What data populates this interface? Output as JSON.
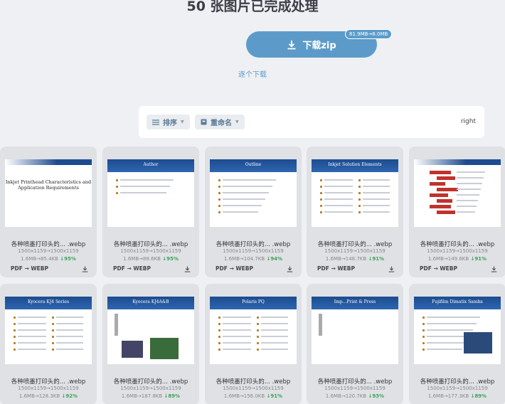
{
  "header": {
    "title": "50 张图片已完成处理",
    "download_label": "下载zip",
    "size_badge": "81.9MB→8.0MB",
    "each_download_label": "逐个下载"
  },
  "toolbar": {
    "sort_label": "排序",
    "rename_label": "重命名",
    "right_label": "right"
  },
  "colors": {
    "accent": "#5c9bc9",
    "saving": "#3fa05a",
    "card_bg": "#dfe1e5"
  },
  "cards": [
    {
      "name": "各种喷墨打印头的...",
      "ext": ".webp",
      "dims": "1500x1159→1500x1159",
      "from": "1.6MB",
      "to": "85.4KB",
      "pct": "95%",
      "fmt_from": "PDF",
      "fmt_to": "WEBP",
      "slide_title": "Inkjet Printhead Characteristics and Application Requirements"
    },
    {
      "name": "各种喷墨打印头的...",
      "ext": ".webp",
      "dims": "1500x1159→1500x1159",
      "from": "1.6MB",
      "to": "88.6KB",
      "pct": "95%",
      "fmt_from": "PDF",
      "fmt_to": "WEBP",
      "slide_title": "Author"
    },
    {
      "name": "各种喷墨打印头的...",
      "ext": ".webp",
      "dims": "1500x1159→1500x1159",
      "from": "1.6MB",
      "to": "104.7KB",
      "pct": "94%",
      "fmt_from": "PDF",
      "fmt_to": "WEBP",
      "slide_title": "Outline"
    },
    {
      "name": "各种喷墨打印头的...",
      "ext": ".webp",
      "dims": "1500x1159→1500x1159",
      "from": "1.6MB",
      "to": "148.7KB",
      "pct": "91%",
      "fmt_from": "PDF",
      "fmt_to": "WEBP",
      "slide_title": "Inkjet Solution Elements"
    },
    {
      "name": "各种喷墨打印头的...",
      "ext": ".webp",
      "dims": "1500x1159→1500x1159",
      "from": "1.6MB",
      "to": "149.6KB",
      "pct": "91%",
      "fmt_from": "PDF",
      "fmt_to": "WEBP",
      "slide_title": ""
    },
    {
      "name": "各种喷墨打印头的...",
      "ext": ".webp",
      "dims": "1500x1159→1500x1159",
      "from": "1.6MB",
      "to": "128.3KB",
      "pct": "92%",
      "slide_title": "Kyocera KJ4 Series"
    },
    {
      "name": "各种喷墨打印头的...",
      "ext": ".webp",
      "dims": "1500x1159→1500x1159",
      "from": "1.6MB",
      "to": "187.8KB",
      "pct": "89%",
      "slide_title": "Kyocera KJ4A&B"
    },
    {
      "name": "各种喷墨打印头的...",
      "ext": ".webp",
      "dims": "1500x1159→1500x1159",
      "from": "1.6MB",
      "to": "156.0KB",
      "pct": "91%",
      "slide_title": "Polaris PQ"
    },
    {
      "name": "各种喷墨打印头的...",
      "ext": ".webp",
      "dims": "1500x1159→1500x1159",
      "from": "1.6MB",
      "to": "120.7KB",
      "pct": "93%",
      "slide_title": "Imp...Print & Press"
    },
    {
      "name": "各种喷墨打印头的...",
      "ext": ".webp",
      "dims": "1500x1159→1500x1159",
      "from": "1.6MB",
      "to": "177.3KB",
      "pct": "89%",
      "slide_title": "Fujifilm Dimatix Samba"
    }
  ]
}
